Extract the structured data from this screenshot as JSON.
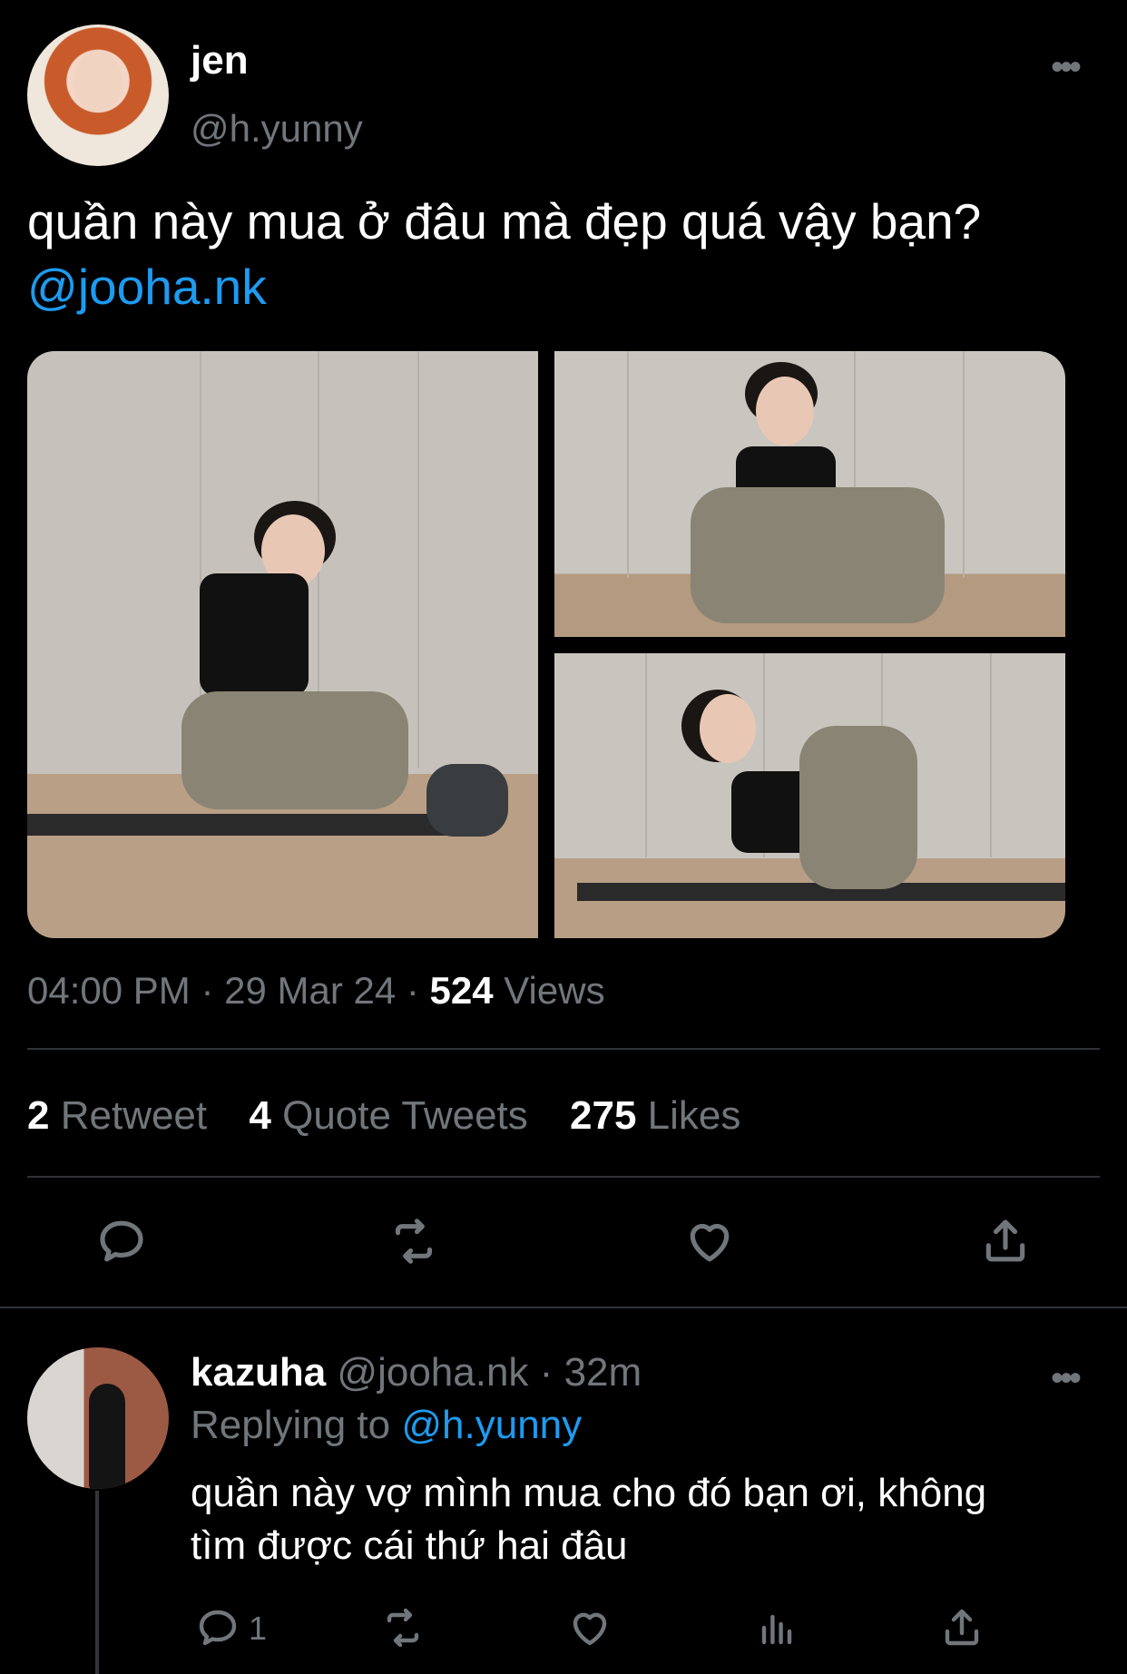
{
  "tweet": {
    "author_name": "jen",
    "author_handle": "@h.yunny",
    "more_label": "•••",
    "text": "quần này mua ở đâu mà đẹp quá vậy bạn?",
    "mention": "@jooha.nk",
    "time": "04:00 PM",
    "date": "29 Mar 24",
    "views_count": "524",
    "views_label": "Views",
    "retweet_count": "2",
    "retweet_label": "Retweet",
    "quote_count": "4",
    "quote_label": "Quote Tweets",
    "likes_count": "275",
    "likes_label": "Likes"
  },
  "reply": {
    "author_name": "kazuha",
    "author_handle": "@jooha.nk",
    "time_ago": "32m",
    "replying_prefix": "Replying to",
    "replying_handle": "@h.yunny",
    "text_line1": "quần này vợ mình mua cho đó bạn ơi, không",
    "text_line2": "tìm được cái thứ hai đâu",
    "reply_count": "1",
    "more_label": "•••"
  },
  "icons": {
    "reply": "reply-icon",
    "retweet": "retweet-icon",
    "like": "heart-icon",
    "share": "share-icon",
    "views": "analytics-icon",
    "more": "more-icon"
  },
  "colors": {
    "background": "#000000",
    "mention": "#1d9bf0",
    "secondary_text": "#71767b"
  }
}
